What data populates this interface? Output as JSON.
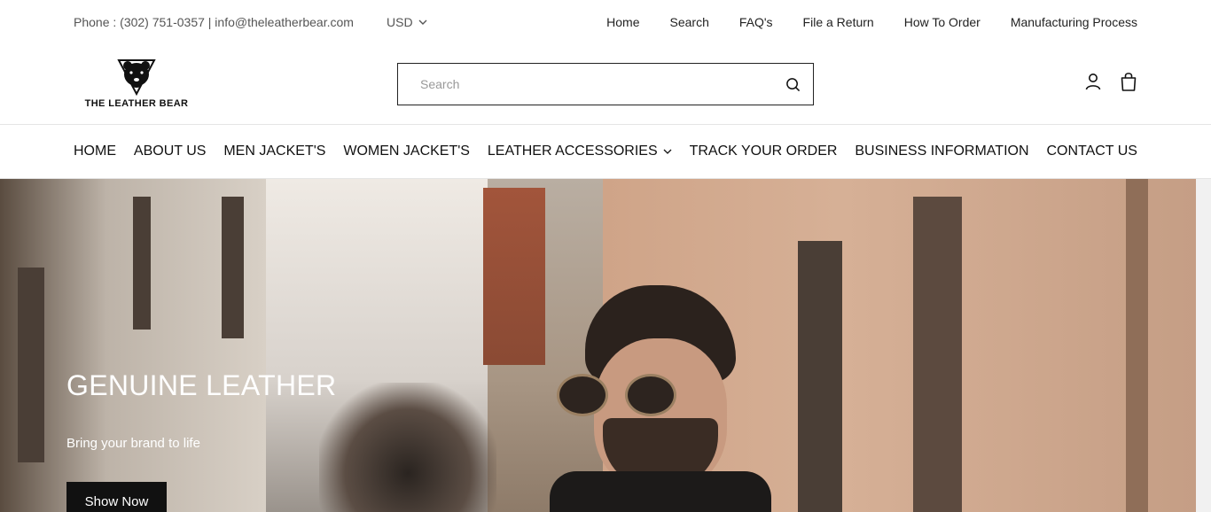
{
  "topbar": {
    "contact": "Phone : (302) 751-0357 | info@theleatherbear.com",
    "currency": "USD",
    "links": [
      "Home",
      "Search",
      "FAQ's",
      "File a Return",
      "How To Order",
      "Manufacturing Process"
    ]
  },
  "header": {
    "logo_text": "THE LEATHER BEAR",
    "search_placeholder": "Search"
  },
  "nav": {
    "items": [
      "HOME",
      "ABOUT US",
      "MEN JACKET'S",
      "WOMEN JACKET'S",
      "LEATHER ACCESSORIES",
      "TRACK YOUR ORDER",
      "BUSINESS INFORMATION",
      "CONTACT US"
    ]
  },
  "hero": {
    "title": "GENUINE LEATHER",
    "subtitle": "Bring your brand to life",
    "button_label": "Show Now"
  },
  "icons": {
    "search": "search-icon",
    "account": "account-icon",
    "cart": "cart-icon",
    "chevron": "chevron-down-icon"
  }
}
